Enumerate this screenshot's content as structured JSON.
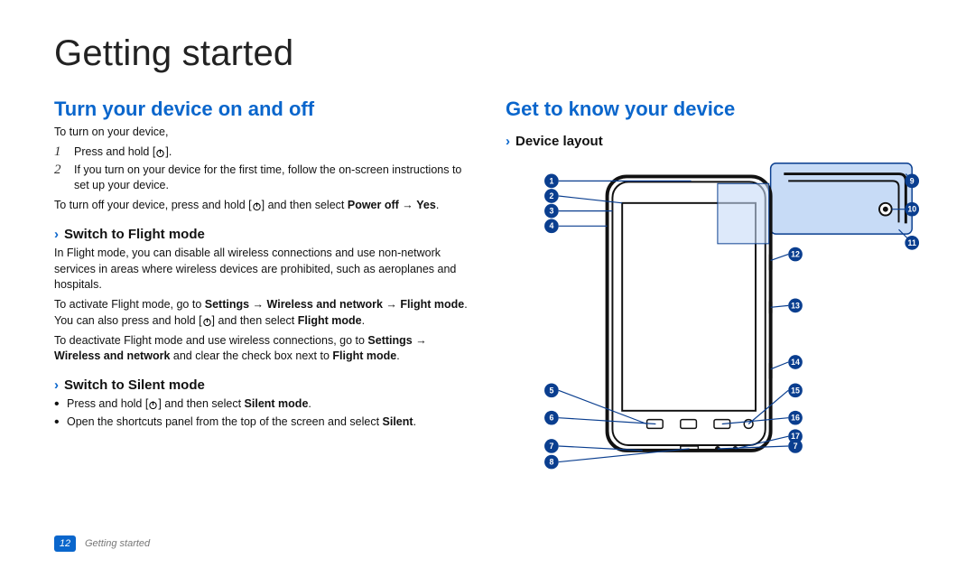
{
  "page_title": "Getting started",
  "footer": {
    "page_number": "12",
    "section": "Getting started"
  },
  "left": {
    "h2": "Turn your device on and off",
    "p1": "To turn on your device,",
    "steps": [
      {
        "n": "1",
        "before": "Press and hold [",
        "after": "]."
      },
      {
        "n": "2",
        "text": "If you turn on your device for the first time, follow the on-screen instructions to set up your device."
      }
    ],
    "p2_before": "To turn off your device, press and hold [",
    "p2_after_a": "] and then select ",
    "p2_bold_a": "Power off",
    "p2_arrow": " → ",
    "p2_bold_b": "Yes",
    "p2_end": ".",
    "h3a": "Switch to Flight mode",
    "flight_p1": "In Flight mode, you can disable all wireless connections and use non-network services in areas where wireless devices are prohibited, such as aeroplanes and hospitals.",
    "flight_p2_a": "To activate Flight mode, go to ",
    "flight_p2_b1": "Settings",
    "flight_p2_ar1": " → ",
    "flight_p2_b2": "Wireless and network",
    "flight_p2_ar2": " → ",
    "flight_p2_b3": "Flight mode",
    "flight_p2_mid": ". You can also press and hold [",
    "flight_p2_after": "] and then select ",
    "flight_p2_b4": "Flight mode",
    "flight_p2_end": ".",
    "flight_p3_a": "To deactivate Flight mode and use wireless connections, go to ",
    "flight_p3_b1": "Settings",
    "flight_p3_ar": " → ",
    "flight_p3_b2": "Wireless and network",
    "flight_p3_mid": " and clear the check box next to ",
    "flight_p3_b3": "Flight mode",
    "flight_p3_end": ".",
    "h3b": "Switch to Silent mode",
    "silent_b1_before": "Press and hold [",
    "silent_b1_after": "] and then select ",
    "silent_b1_bold": "Silent mode",
    "silent_b1_end": ".",
    "silent_b2_a": "Open the shortcuts panel from the top of the screen and select ",
    "silent_b2_bold": "Silent",
    "silent_b2_end": "."
  },
  "right": {
    "h2": "Get to know your device",
    "h3": "Device layout",
    "callouts": [
      "1",
      "2",
      "3",
      "4",
      "5",
      "6",
      "7",
      "8",
      "9",
      "10",
      "11",
      "12",
      "13",
      "14",
      "15",
      "16",
      "17",
      "7"
    ]
  },
  "chevron": "›"
}
